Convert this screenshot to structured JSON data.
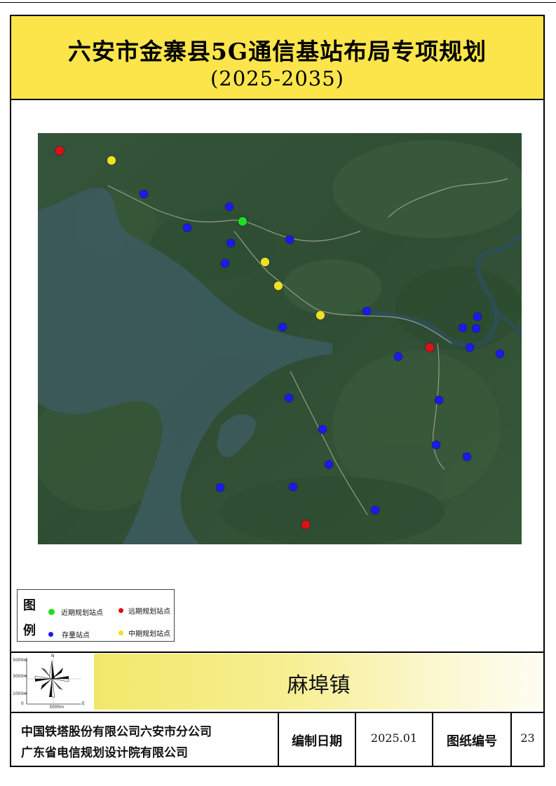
{
  "title": {
    "line1": "六安市金寨县5G通信基站布局专项规划",
    "line2": "(2025-2035)"
  },
  "legend": {
    "char1": "图",
    "char2": "例",
    "items": [
      {
        "label": "近期规划站点",
        "color": "#22dd22"
      },
      {
        "label": "远期规划站点",
        "color": "#dd1111"
      },
      {
        "label": "存量站点",
        "color": "#1a1aee"
      },
      {
        "label": "中期规划站点",
        "color": "#f0e020"
      }
    ]
  },
  "scale": {
    "y_top": "5000m",
    "y_mid": "3000m",
    "y_low": "1000m",
    "y_zero": "0",
    "x_label": "3000m",
    "north": "N",
    "east": "E"
  },
  "town": "麻埠镇",
  "footer": {
    "org1": "中国铁塔股份有限公司六安市分公司",
    "org2": "广东省电信规划设计院有限公司",
    "date_label": "编制日期",
    "date_value": "2025.01",
    "drawing_label": "图纸编号",
    "drawing_value": "23"
  },
  "colors": {
    "title_bg": "#fbe54a",
    "stock": "#1a1aee",
    "near": "#22dd22",
    "mid": "#f0e020",
    "far": "#dd1111"
  },
  "map_points": {
    "stock": [
      [
        205,
        277
      ],
      [
        327,
        295
      ],
      [
        267,
        325
      ],
      [
        329,
        347
      ],
      [
        413,
        342
      ],
      [
        321,
        376
      ],
      [
        523,
        444
      ],
      [
        403,
        467
      ],
      [
        681,
        452
      ],
      [
        660,
        468
      ],
      [
        679,
        469
      ],
      [
        670,
        496
      ],
      [
        713,
        505
      ],
      [
        568,
        509
      ],
      [
        412,
        568
      ],
      [
        626,
        571
      ],
      [
        460,
        613
      ],
      [
        622,
        635
      ],
      [
        666,
        652
      ],
      [
        469,
        663
      ],
      [
        314,
        696
      ],
      [
        418,
        695
      ],
      [
        535,
        728
      ]
    ],
    "near": [
      [
        346,
        316
      ]
    ],
    "mid": [
      [
        159,
        229
      ],
      [
        378,
        374
      ],
      [
        397,
        408
      ],
      [
        457,
        450
      ]
    ],
    "far": [
      [
        85,
        215
      ],
      [
        613,
        496
      ],
      [
        436,
        749
      ]
    ]
  }
}
